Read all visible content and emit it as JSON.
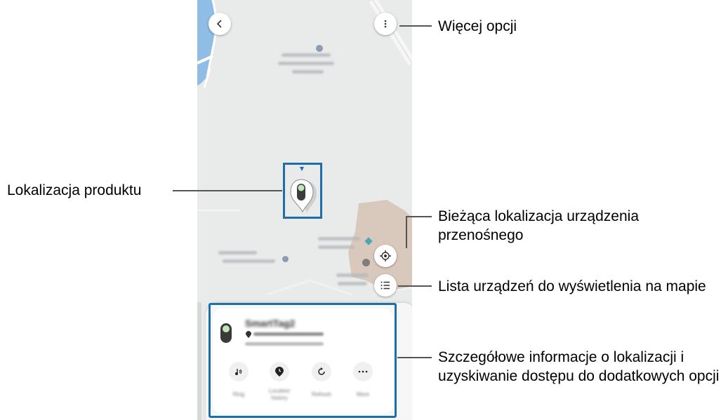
{
  "device": {
    "name": "SmartTag2"
  },
  "actions": [
    {
      "label": "Ring",
      "icon": "music-note-icon"
    },
    {
      "label": "Location history",
      "icon": "location-history-icon"
    },
    {
      "label": "Refresh",
      "icon": "refresh-icon"
    },
    {
      "label": "More",
      "icon": "more-icon"
    }
  ],
  "callouts": {
    "more_options": "Więcej opcji",
    "product_location": "Lokalizacja produktu",
    "current_location": "Bieżąca lokalizacja urządzenia przenośnego",
    "device_list": "Lista urządzeń do wyświetlenia na mapie",
    "details": "Szczegółowe informacje o lokalizacji i uzyskiwanie dostępu do dodatkowych opcji"
  },
  "colors": {
    "highlight": "#1d6fa8",
    "map_background": "#e9ebea",
    "water": "#7fb3e0",
    "building": "#d8c7b8"
  }
}
